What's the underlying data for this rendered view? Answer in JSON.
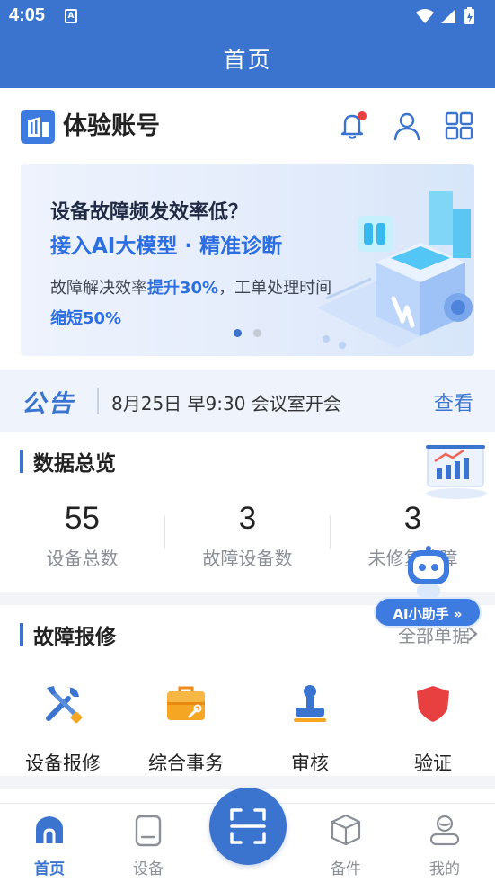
{
  "status_bar": {
    "time": "4:05",
    "sim_label": "A"
  },
  "app_bar": {
    "title": "首页"
  },
  "account": {
    "name": "体验账号"
  },
  "banner": {
    "headline": "设备故障频发效率低？",
    "subheadline": "接入AI大模型 · 精准诊断",
    "desc_prefix": "故障解决效率",
    "desc_highlight": "提升30%",
    "desc_suffix": "，工单处理时间",
    "desc_line2": "缩短50%",
    "carousel_index": 1,
    "carousel_count": 2
  },
  "notice": {
    "tag": "公告",
    "text": "8月25日 早9:30 会议室开会",
    "link": "查看"
  },
  "data_overview": {
    "title": "数据总览",
    "stats": [
      {
        "value": "55",
        "label": "设备总数"
      },
      {
        "value": "3",
        "label": "故障设备数"
      },
      {
        "value": "3",
        "label": "未修复故障"
      }
    ]
  },
  "repair": {
    "title": "故障报修",
    "all_orders": "全部单据",
    "actions": [
      {
        "label": "设备报修",
        "icon": "tools-icon"
      },
      {
        "label": "综合事务",
        "icon": "toolbox-icon"
      },
      {
        "label": "审核",
        "icon": "stamp-icon"
      },
      {
        "label": "验证",
        "icon": "shield-check-icon"
      }
    ]
  },
  "ai_helper": {
    "label": "AI小助手 »"
  },
  "tab_bar": {
    "items": [
      {
        "label": "首页",
        "icon": "home-icon"
      },
      {
        "label": "设备",
        "icon": "device-icon"
      },
      {
        "label": "备件",
        "icon": "box-icon"
      },
      {
        "label": "我的",
        "icon": "profile-icon"
      }
    ],
    "center_icon": "scan-icon"
  },
  "colors": {
    "primary": "#3a74cf",
    "accent_orange": "#f5a623",
    "alert_red": "#e84040"
  }
}
